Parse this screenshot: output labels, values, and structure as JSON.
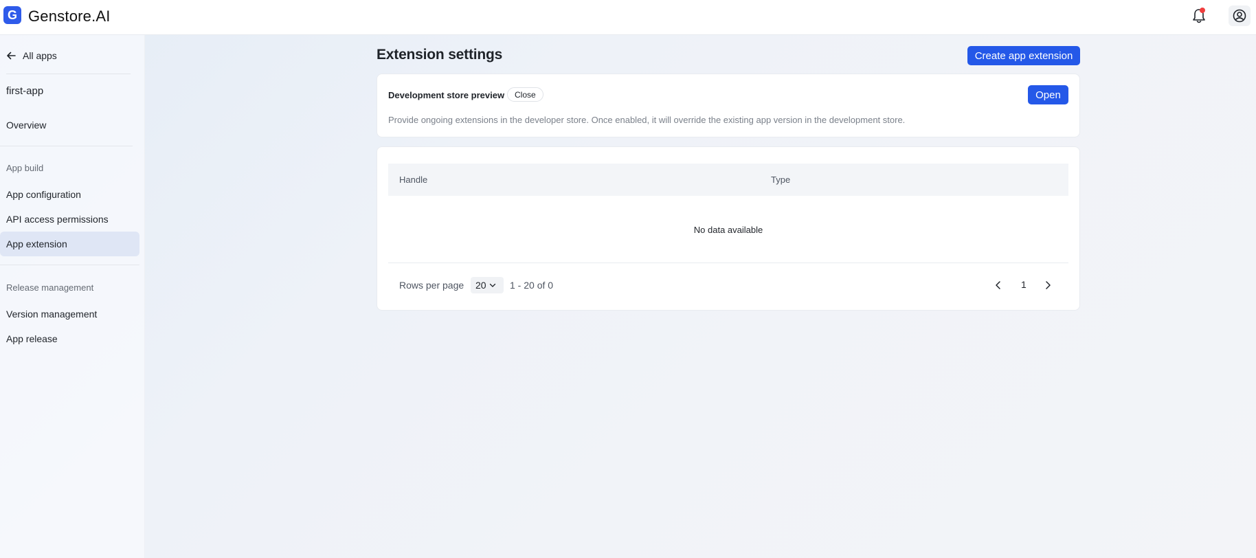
{
  "brand": {
    "name": "Genstore.AI",
    "logo_letter": "G",
    "logo_color": "#2f5bea"
  },
  "header": {
    "bell_icon": "bell-icon",
    "account_icon": "user-circle-icon",
    "notification_dot_color": "#f03e3e"
  },
  "sidebar": {
    "back_label": "All apps",
    "app_name": "first-app",
    "overview_label": "Overview",
    "groups": [
      {
        "title": "App build",
        "items": [
          "App configuration",
          "API access permissions",
          "App extension"
        ]
      },
      {
        "title": "Release management",
        "items": [
          "Version management",
          "App release"
        ]
      }
    ],
    "active_item": "App extension"
  },
  "main": {
    "title": "Extension settings",
    "create_button": "Create app extension",
    "preview": {
      "title": "Development store preview",
      "status_tag": "Close",
      "open_button": "Open",
      "description": "Provide ongoing extensions in the developer store. Once enabled, it will override the existing app version in the development store."
    },
    "table": {
      "columns": [
        "Handle",
        "Type"
      ],
      "empty_text": "No data available",
      "rows_per_page_label": "Rows per page",
      "rows_per_page_value": "20",
      "range_text": "1 - 20 of 0",
      "current_page": "1"
    }
  },
  "colors": {
    "primary": "#2458e8",
    "active_nav_bg": "#dfe6f5"
  }
}
